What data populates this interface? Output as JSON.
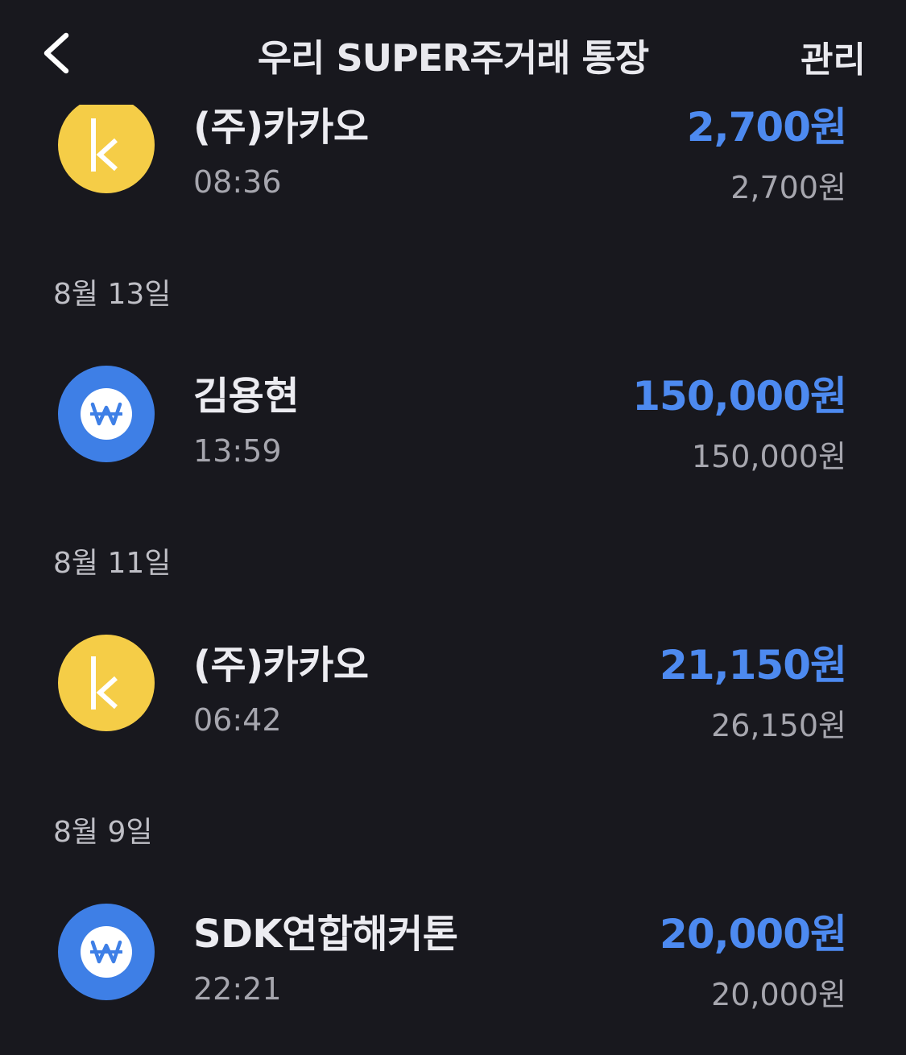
{
  "header": {
    "title": "우리 SUPER주거래 통장",
    "manage_label": "관리",
    "back_icon": "chevron-left-icon"
  },
  "colors": {
    "background": "#18181e",
    "amount_blue": "#4d8af0",
    "kakao_yellow": "#f5cd47",
    "won_blue": "#3e7fe6"
  },
  "transactions": {
    "t0": {
      "name": "(주)카카오",
      "time": "08:36",
      "amount": "2,700원",
      "balance": "2,700원",
      "icon": "kakao-k-icon"
    },
    "t1": {
      "name": "김용현",
      "time": "13:59",
      "amount": "150,000원",
      "balance": "150,000원",
      "icon": "won-icon"
    },
    "t2": {
      "name": "(주)카카오",
      "time": "06:42",
      "amount": "21,150원",
      "balance": "26,150원",
      "icon": "kakao-k-icon"
    },
    "t3": {
      "name": "SDK연합해커톤",
      "time": "22:21",
      "amount": "20,000원",
      "balance": "20,000원",
      "icon": "won-icon"
    }
  },
  "dates": {
    "d1": "8월 13일",
    "d2": "8월 11일",
    "d3": "8월 9일"
  }
}
